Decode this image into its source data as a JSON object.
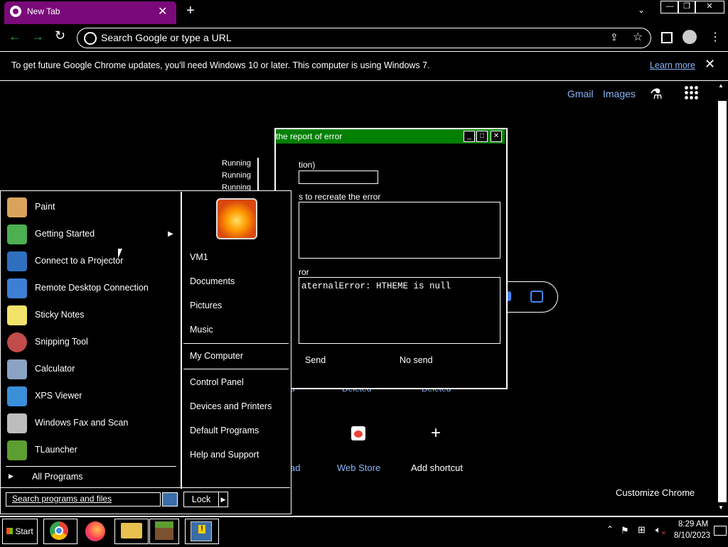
{
  "browser": {
    "tab_title": "New Tab",
    "omnibox_placeholder": "Search Google or type a URL",
    "infobar_text": "To get future Google Chrome updates, you'll need Windows 10 or later. This computer is using Windows 7.",
    "infobar_link": "Learn more"
  },
  "ntp": {
    "gmail": "Gmail",
    "images": "Images",
    "running": [
      "Running",
      "Running",
      "Running"
    ],
    "shortcuts": [
      {
        "label": "ad",
        "status": ""
      },
      {
        "label": "Web Store",
        "status": "Deleted"
      },
      {
        "label": "Add shortcut",
        "status": "Deleted"
      }
    ],
    "customize": "Customize Chrome",
    "deleted_frag": "d"
  },
  "dialog": {
    "title": "the report of error",
    "label_action": "tion)",
    "label_steps": "s to recreate the error",
    "label_error": "ror",
    "error_text": "aternalError: HTHEME is null",
    "send": "Send",
    "no_send": "No send"
  },
  "start_menu": {
    "programs": [
      {
        "label": "Paint",
        "icon": "paint-icon",
        "color": "#d9a35c"
      },
      {
        "label": "Getting Started",
        "icon": "getting-started-icon",
        "color": "#4caf50",
        "submenu": true
      },
      {
        "label": "Connect to a Projector",
        "icon": "projector-icon",
        "color": "#2f6fbf"
      },
      {
        "label": "Remote Desktop Connection",
        "icon": "remote-desktop-icon",
        "color": "#3d7fd6"
      },
      {
        "label": "Sticky Notes",
        "icon": "sticky-notes-icon",
        "color": "#f2e36b"
      },
      {
        "label": "Snipping Tool",
        "icon": "snipping-tool-icon",
        "color": "#c24b4b"
      },
      {
        "label": "Calculator",
        "icon": "calculator-icon",
        "color": "#8aa3c2"
      },
      {
        "label": "XPS Viewer",
        "icon": "xps-viewer-icon",
        "color": "#3a8fd9"
      },
      {
        "label": "Windows Fax and Scan",
        "icon": "fax-scan-icon",
        "color": "#bdbdbd"
      },
      {
        "label": "TLauncher",
        "icon": "tlauncher-icon",
        "color": "#5c9e31"
      }
    ],
    "all_programs": "All Programs",
    "search_placeholder": "Search programs and files",
    "user": "VM1",
    "right_items_1": [
      "Documents",
      "Pictures",
      "Music"
    ],
    "my_computer": "My Computer",
    "right_items_2": [
      "Control Panel",
      "Devices and Printers",
      "Default Programs",
      "Help and Support"
    ],
    "lock": "Lock"
  },
  "taskbar": {
    "start": "Start",
    "time": "8:29 AM",
    "date": "8/10/2023"
  }
}
